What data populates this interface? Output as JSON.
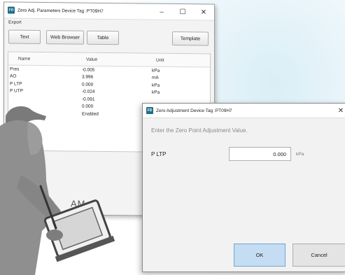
{
  "params_window": {
    "icon": "FD",
    "title": "Zero Adj. Parameters  Device Tag :PT09H7",
    "controls": {
      "minimize": "–",
      "maximize": "☐",
      "close": "✕"
    },
    "menu": {
      "export": "Export"
    },
    "toolbar": {
      "text_button": "Text",
      "web_browser_button": "Web Browser",
      "table_button": "Table",
      "template_button": "Template"
    },
    "table": {
      "headers": {
        "name": "Name",
        "value": "Value",
        "unit": "Unit"
      },
      "rows": [
        {
          "name": "Pres",
          "value": "-0.005",
          "unit": "kPa"
        },
        {
          "name": "AO",
          "value": "3.996",
          "unit": "mA"
        },
        {
          "name": "P LTP",
          "value": "0.000",
          "unit": "kPa"
        },
        {
          "name": "P UTP",
          "value": "-0.024",
          "unit": "kPa"
        },
        {
          "name": "",
          "value": "-0.091",
          "unit": ""
        },
        {
          "name": "",
          "value": "0.000",
          "unit": ""
        },
        {
          "name": "",
          "value": "Enabled",
          "unit": ""
        }
      ]
    },
    "footer_text": "AM"
  },
  "zero_dialog": {
    "icon": "FD",
    "title": "Zero Adjustment  Device Tag :PT09H7",
    "close": "✕",
    "prompt": "Enter the Zero Point Adjustment Value.",
    "field_label": "P LTP",
    "field_value": "0.000",
    "field_unit": "kPa",
    "ok_button": "OK",
    "cancel_button": "Cancel"
  },
  "colors": {
    "accent": "#1f6f8b",
    "ok_button_bg": "#c5ddf2",
    "window_bg": "#f3f3f3",
    "silhouette": "#8f8f8f"
  },
  "icons": [
    "app-icon",
    "close-icon",
    "minimize-icon",
    "maximize-icon"
  ]
}
